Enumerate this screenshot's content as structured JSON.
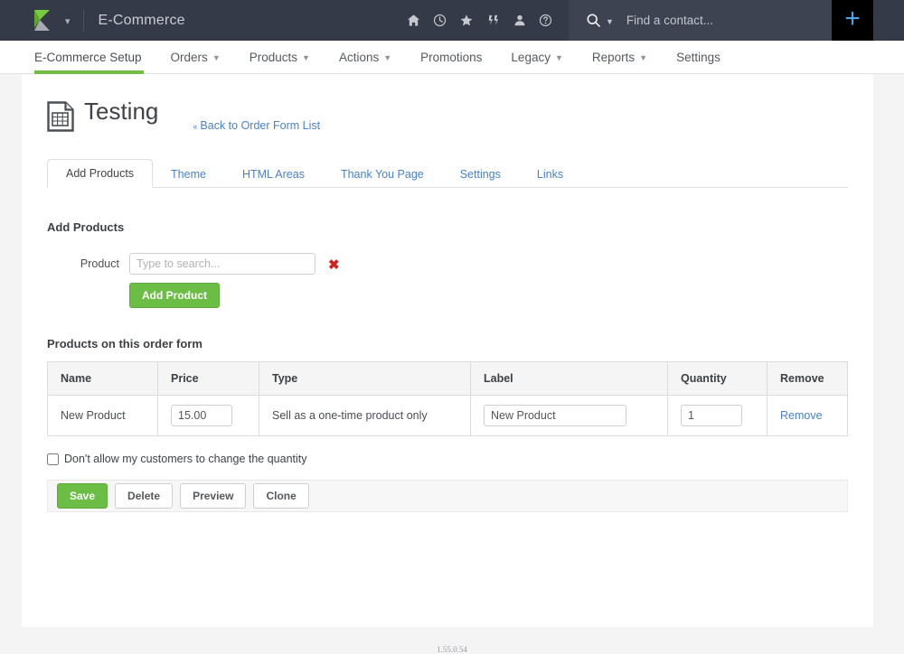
{
  "topbar": {
    "app_title": "E-Commerce",
    "logo_icon": "keap-logo-icon",
    "logo_caret_icon": "chevron-down-icon",
    "icons": [
      {
        "name": "home-icon",
        "label": "Home"
      },
      {
        "name": "clock-icon",
        "label": "Recent"
      },
      {
        "name": "star-icon",
        "label": "Favorites"
      },
      {
        "name": "campaign-icon",
        "label": "Campaigns"
      },
      {
        "name": "person-icon",
        "label": "Contacts"
      },
      {
        "name": "help-icon",
        "label": "Help"
      }
    ],
    "search": {
      "icon": "search-icon",
      "caret_icon": "caret-down-icon",
      "placeholder": "Find a contact..."
    },
    "add_button_label": "+",
    "accent_blue": "#4ea4e8",
    "bar_bg": "#343a47"
  },
  "nav": {
    "items": [
      {
        "label": "E-Commerce Setup",
        "has_caret": false,
        "active": true
      },
      {
        "label": "Orders",
        "has_caret": true,
        "active": false
      },
      {
        "label": "Products",
        "has_caret": true,
        "active": false
      },
      {
        "label": "Actions",
        "has_caret": true,
        "active": false
      },
      {
        "label": "Promotions",
        "has_caret": false,
        "active": false
      },
      {
        "label": "Legacy",
        "has_caret": true,
        "active": false
      },
      {
        "label": "Reports",
        "has_caret": true,
        "active": false
      },
      {
        "label": "Settings",
        "has_caret": false,
        "active": false
      }
    ],
    "active_underline_color": "#76bc43"
  },
  "header": {
    "icon": "order-form-icon",
    "title": "Testing",
    "back_link": "Back to Order Form List",
    "back_arrow": "«"
  },
  "subtabs": [
    {
      "label": "Add Products",
      "active": true
    },
    {
      "label": "Theme",
      "active": false
    },
    {
      "label": "HTML Areas",
      "active": false
    },
    {
      "label": "Thank You Page",
      "active": false
    },
    {
      "label": "Settings",
      "active": false
    },
    {
      "label": "Links",
      "active": false
    }
  ],
  "add_products": {
    "section_title": "Add Products",
    "product_label": "Product",
    "product_placeholder": "Type to search...",
    "product_value": "",
    "remove_icon": "red-x-icon",
    "add_button_label": "Add Product"
  },
  "products_table": {
    "title": "Products on this order form",
    "columns": [
      "Name",
      "Price",
      "Type",
      "Label",
      "Quantity",
      "Remove"
    ],
    "rows": [
      {
        "name": "New Product",
        "price": "15.00",
        "type": "Sell as a one-time product only",
        "label": "New Product",
        "quantity": "1",
        "remove": "Remove"
      }
    ]
  },
  "options": {
    "lock_quantity_label": "Don't allow my customers to change the quantity",
    "lock_quantity_checked": false
  },
  "actions": {
    "save": "Save",
    "delete": "Delete",
    "preview": "Preview",
    "clone": "Clone",
    "save_color": "#6bbd45"
  },
  "footer": {
    "version": "1.55.0.54"
  }
}
